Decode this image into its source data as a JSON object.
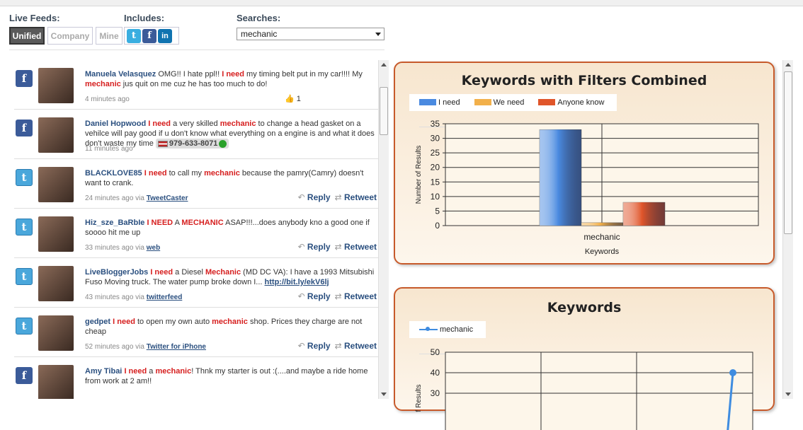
{
  "filters": {
    "live_feeds_label": "Live Feeds:",
    "includes_label": "Includes:",
    "searches_label": "Searches:",
    "feed_buttons": [
      "Unified",
      "Company",
      "Mine"
    ],
    "network_icons": [
      {
        "icon": "twitter-icon",
        "glyph": "t"
      },
      {
        "icon": "facebook-icon",
        "glyph": "f"
      },
      {
        "icon": "linkedin-icon",
        "glyph": "in"
      }
    ],
    "search_value": "mechanic"
  },
  "feed": [
    {
      "network": "facebook",
      "name": "Manuela Velasquez",
      "text": [
        [
          "OMG!! I hate ppl!! ",
          ""
        ],
        [
          "I need",
          "kw"
        ],
        [
          " my timing belt put in my car!!!! My ",
          ""
        ],
        [
          "mechanic",
          "kw"
        ],
        [
          " jus quit on me cuz he has too much to do!",
          ""
        ]
      ],
      "time": "4 minutes ago",
      "likes": "1"
    },
    {
      "network": "facebook",
      "name": "Daniel Hopwood",
      "text": [
        [
          "I need",
          "kw"
        ],
        [
          " a very skilled ",
          ""
        ],
        [
          "mechanic",
          "kw"
        ],
        [
          " to change a head gasket on a vehilce will pay good if u don't know what everything on a engine is and what it does don't waste my time ",
          ""
        ]
      ],
      "phone": "979-633-8071",
      "time": "11 minutes ago"
    },
    {
      "network": "twitter",
      "name": "BLACKLOVE85",
      "text": [
        [
          "I need",
          "kw"
        ],
        [
          " to call my ",
          ""
        ],
        [
          "mechanic",
          "kw"
        ],
        [
          " because the pamry(Camry) doesn't want to crank.",
          ""
        ]
      ],
      "time": "24 minutes ago",
      "via": "via",
      "source": "TweetCaster",
      "reply": "Reply",
      "retweet": "Retweet"
    },
    {
      "network": "twitter",
      "name": "Hiz_sze_BaRbIe",
      "text": [
        [
          "I NEED",
          "kw"
        ],
        [
          " A ",
          ""
        ],
        [
          "MECHANIC",
          "kw"
        ],
        [
          " ASAP!!!...does anybody kno a good one if soooo hit me up",
          ""
        ]
      ],
      "time": "33 minutes ago",
      "via": "via",
      "source": "web",
      "reply": "Reply",
      "retweet": "Retweet"
    },
    {
      "network": "twitter",
      "name": "LiveBloggerJobs",
      "text": [
        [
          "I need",
          "kw"
        ],
        [
          " a Diesel ",
          ""
        ],
        [
          "Mechanic",
          "kw"
        ],
        [
          " (MD DC VA): I have a 1993 Mitsubishi Fuso Moving truck. The water pump broke down I... ",
          ""
        ],
        [
          "http://bit.ly/ekV6lj",
          "link"
        ]
      ],
      "time": "43 minutes ago",
      "via": "via",
      "source": "twitterfeed",
      "reply": "Reply",
      "retweet": "Retweet"
    },
    {
      "network": "twitter",
      "name": "gedpet",
      "text": [
        [
          "I need",
          "kw"
        ],
        [
          " to open my own auto ",
          ""
        ],
        [
          "mechanic",
          "kw"
        ],
        [
          " shop. Prices they charge are not cheap",
          ""
        ]
      ],
      "time": "52 minutes ago",
      "via": "via",
      "source": "Twitter for iPhone",
      "reply": "Reply",
      "retweet": "Retweet"
    },
    {
      "network": "facebook",
      "name": "Amy Tibai",
      "text": [
        [
          "I need",
          "kw"
        ],
        [
          " a ",
          ""
        ],
        [
          "mechanic",
          "kw"
        ],
        [
          "! Thnk my starter is out :(....and maybe a ride home from work at 2 am!!",
          ""
        ]
      ],
      "time": ""
    }
  ],
  "chart_data": [
    {
      "type": "bar",
      "title": "Keywords with Filters Combined",
      "categories": [
        "mechanic"
      ],
      "series": [
        {
          "name": "I need",
          "values": [
            33
          ],
          "color": "#4a8ae0"
        },
        {
          "name": "We need",
          "values": [
            1
          ],
          "color": "#f2b04a"
        },
        {
          "name": "Anyone know",
          "values": [
            8
          ],
          "color": "#e0552a"
        }
      ],
      "xlabel": "Keywords",
      "ylabel": "Number of Results",
      "ylim": [
        0,
        35
      ],
      "yticks": [
        "0",
        "5",
        "10",
        "15",
        "20",
        "25",
        "30",
        "35"
      ],
      "legend": "top-left",
      "grid": true
    },
    {
      "type": "line",
      "title": "Keywords",
      "series": [
        {
          "name": "mechanic",
          "values": [
            40
          ],
          "color": "#3f8ce0"
        }
      ],
      "ylabel": "f Results",
      "ylim": [
        30,
        50
      ],
      "yticks": [
        "30",
        "40",
        "50"
      ],
      "legend": "top-left",
      "grid": true
    }
  ],
  "colors": {
    "keyword": "#d61f1f",
    "name": "#2a4f7f",
    "panel_border": "#c75a2b"
  }
}
